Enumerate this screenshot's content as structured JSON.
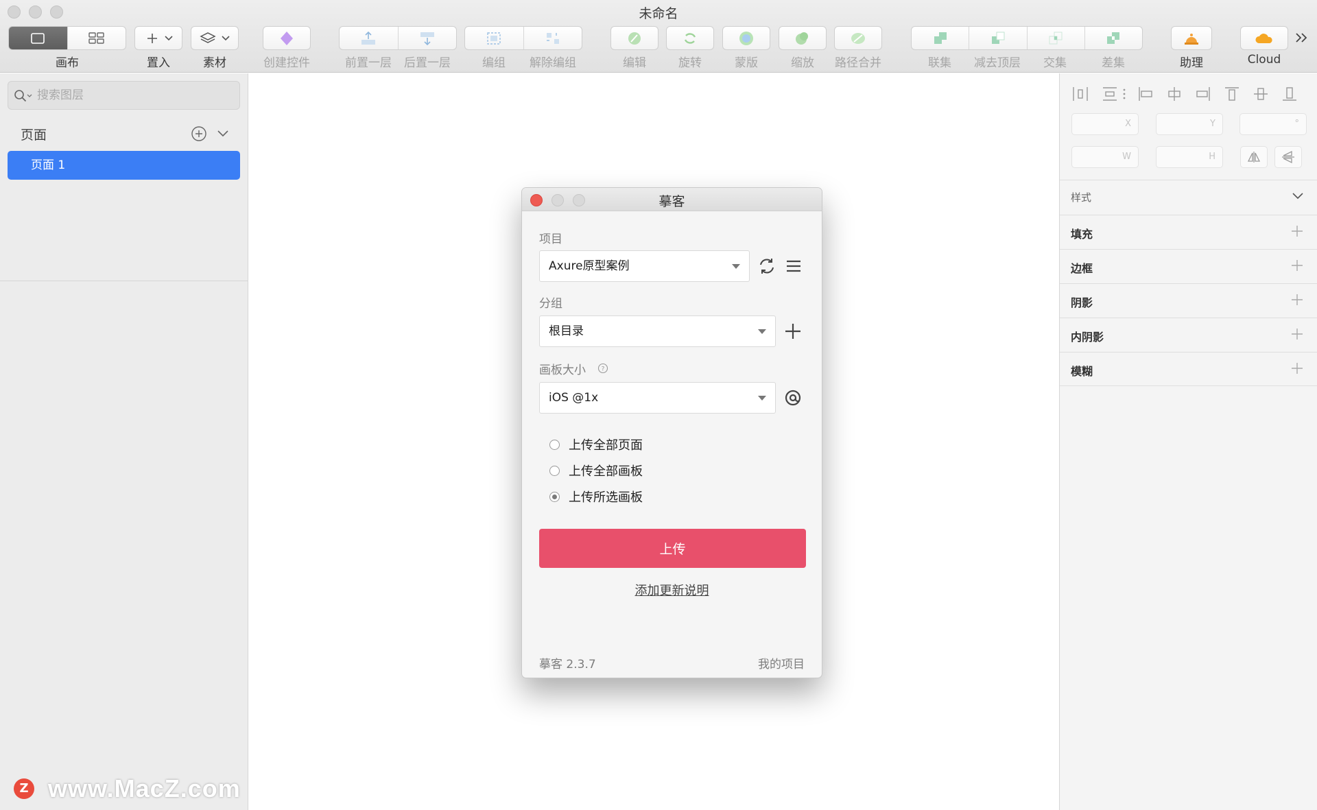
{
  "window": {
    "title": "未命名"
  },
  "toolbar": {
    "canvas_label": "画布",
    "insert_label": "置入",
    "assets_label": "素材",
    "create_symbol_label": "创建控件",
    "forward_label": "前置一层",
    "backward_label": "后置一层",
    "group_label": "编组",
    "ungroup_label": "解除编组",
    "edit_label": "编辑",
    "rotate_label": "旋转",
    "mask_label": "蒙版",
    "scale_label": "缩放",
    "flatten_label": "路径合并",
    "union_label": "联集",
    "subtract_label": "减去顶层",
    "intersect_label": "交集",
    "difference_label": "差集",
    "assistant_label": "助理",
    "cloud_label": "Cloud"
  },
  "sidebar": {
    "search_placeholder": "搜索图层",
    "pages_header": "页面",
    "pages": [
      "页面 1"
    ]
  },
  "inspector": {
    "x_label": "X",
    "y_label": "Y",
    "rotation_label": "°",
    "w_label": "W",
    "h_label": "H",
    "style_header": "样式",
    "sections": [
      "填充",
      "边框",
      "阴影",
      "内阴影",
      "模糊"
    ]
  },
  "dialog": {
    "title": "摹客",
    "project_label": "项目",
    "project_value": "Axure原型案例",
    "group_label": "分组",
    "group_value": "根目录",
    "artboard_size_label": "画板大小",
    "artboard_size_value": "iOS @1x",
    "upload_options": [
      {
        "label": "上传全部页面",
        "selected": false
      },
      {
        "label": "上传全部画板",
        "selected": false
      },
      {
        "label": "上传所选画板",
        "selected": true
      }
    ],
    "upload_button": "上传",
    "add_notes_link": "添加更新说明",
    "version": "摹客 2.3.7",
    "my_projects_link": "我的项目"
  },
  "watermark": {
    "logo_letter": "Z",
    "text": "www.MacZ.com"
  },
  "colors": {
    "accent_blue": "#3b7ef5",
    "upload_red": "#e8506b",
    "close_red": "#ee5a52"
  }
}
